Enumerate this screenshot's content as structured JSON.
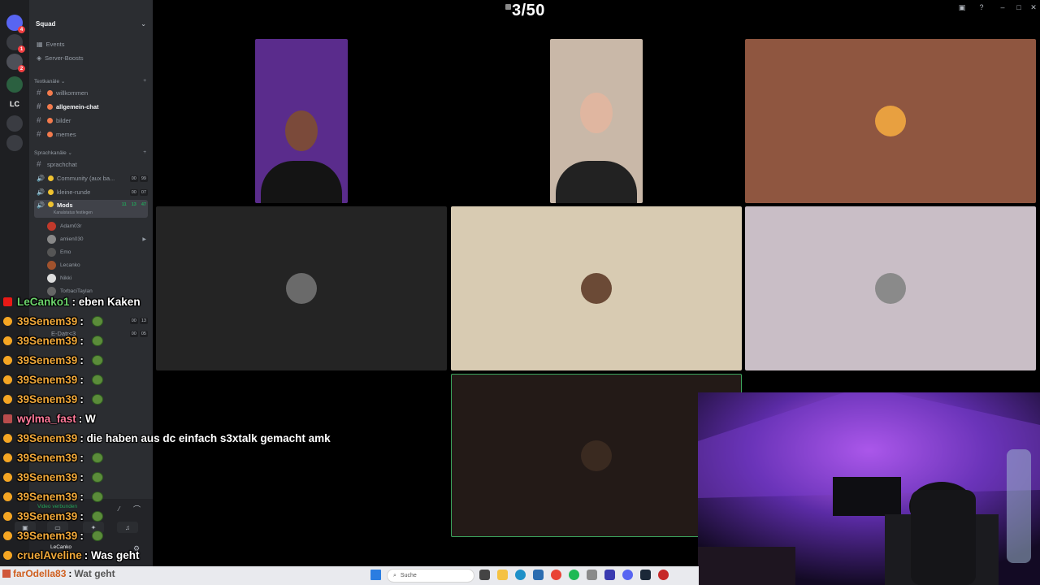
{
  "viewer_count": "3/50",
  "server": {
    "name": "Squad"
  },
  "rail": [
    {
      "label": "",
      "color": "#5865f2",
      "badge": "4"
    },
    {
      "label": "",
      "color": "#3a3c42",
      "badge": "1"
    },
    {
      "label": "",
      "color": "#4e5058",
      "badge": "2"
    },
    {
      "label": "",
      "color": "#2b6040",
      "badge": ""
    },
    {
      "label": "LC",
      "color": "#1e1f22",
      "badge": ""
    },
    {
      "label": "",
      "color": "#3a3c42",
      "badge": ""
    },
    {
      "label": "",
      "color": "#3a3c42",
      "badge": ""
    }
  ],
  "sidebar": {
    "top_items": [
      "Events",
      "Server-Boosts"
    ],
    "text_category": "Textkanäle",
    "text_channels": [
      "willkommen",
      "allgemein-chat",
      "bilder",
      "memes"
    ],
    "voice_category": "Sprachkanäle",
    "voice_channels": [
      {
        "name": "sprachchat",
        "counter": []
      },
      {
        "name": "Community (aux ba...",
        "counter": [
          "00",
          "99"
        ]
      },
      {
        "name": "kleine-runde",
        "counter": [
          "00",
          "07"
        ]
      },
      {
        "name": "Mods",
        "counter": [
          "11",
          "13",
          "47"
        ]
      }
    ],
    "mods_status": "Kanalstatus festlegen",
    "members": [
      "Adam03r",
      "amien030",
      "Emo",
      "Lecanko",
      "Nikki",
      "TorbaciTaylan"
    ],
    "extra_counters": [
      [
        "00",
        "13"
      ],
      [
        "00",
        "05"
      ]
    ],
    "extra_channel": "E-Datr<3",
    "voice_status": "Video verbunden",
    "user": "LeCanko"
  },
  "chat": [
    {
      "user": "LeCanko1",
      "text": "eben Kaken",
      "color": "green",
      "badge": "red",
      "emote": false
    },
    {
      "user": "39Senem39",
      "text": "",
      "color": "gold",
      "badge": "gold",
      "emote": true
    },
    {
      "user": "39Senem39",
      "text": "",
      "color": "gold",
      "badge": "gold",
      "emote": true
    },
    {
      "user": "39Senem39",
      "text": "",
      "color": "gold",
      "badge": "gold",
      "emote": true
    },
    {
      "user": "39Senem39",
      "text": "",
      "color": "gold",
      "badge": "gold",
      "emote": true
    },
    {
      "user": "39Senem39",
      "text": "",
      "color": "gold",
      "badge": "gold",
      "emote": true
    },
    {
      "user": "wylma_fast",
      "text": "W",
      "color": "pink",
      "badge": "mod",
      "emote": false
    },
    {
      "user": "39Senem39",
      "text": "die haben aus dc einfach s3xtalk gemacht amk",
      "color": "gold",
      "badge": "gold",
      "emote": false
    },
    {
      "user": "39Senem39",
      "text": "",
      "color": "gold",
      "badge": "gold",
      "emote": true
    },
    {
      "user": "39Senem39",
      "text": "",
      "color": "gold",
      "badge": "gold",
      "emote": true
    },
    {
      "user": "39Senem39",
      "text": "",
      "color": "gold",
      "badge": "gold",
      "emote": true
    },
    {
      "user": "39Senem39",
      "text": "",
      "color": "gold",
      "badge": "gold",
      "emote": true
    },
    {
      "user": "39Senem39",
      "text": "",
      "color": "gold",
      "badge": "gold",
      "emote": true
    },
    {
      "user": "cruelAveline",
      "text": "Was geht",
      "color": "gold",
      "badge": "gold",
      "emote": false
    }
  ],
  "bottom_msg": {
    "user": "farOdella83",
    "text": "Wat geht"
  },
  "taskbar": {
    "search_placeholder": "Suche"
  },
  "tiles": [
    {
      "kind": "cam",
      "bg": "#5a2c8c"
    },
    {
      "kind": "cam",
      "bg": "#c9b8a8"
    },
    {
      "kind": "avatar",
      "bg": "#8f5640",
      "avatar_color": "#e8a040"
    },
    {
      "kind": "avatar",
      "bg": "#242424",
      "avatar_color": "#6a6a6a"
    },
    {
      "kind": "avatar",
      "bg": "#d8cbb2",
      "avatar_color": "#6b4a36"
    },
    {
      "kind": "avatar",
      "bg": "#c9bec6",
      "avatar_color": "#8a8a8a"
    },
    {
      "kind": "avatar",
      "bg": "#231a17",
      "avatar_color": "#3a2a20",
      "speaking": true
    }
  ]
}
